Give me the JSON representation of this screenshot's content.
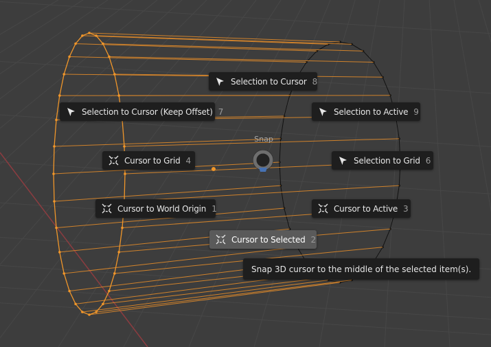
{
  "pie_menu": {
    "title": "Snap",
    "items": [
      {
        "label": "Selection to Cursor",
        "number": "8",
        "icon": "cursor-arrow-icon",
        "active": false
      },
      {
        "label": "Selection to Cursor (Keep Offset)",
        "number": "7",
        "icon": "cursor-arrow-icon",
        "active": false
      },
      {
        "label": "Selection to Active",
        "number": "9",
        "icon": "cursor-arrow-icon",
        "active": false
      },
      {
        "label": "Cursor to Grid",
        "number": "4",
        "icon": "3d-cursor-icon",
        "active": false
      },
      {
        "label": "Selection to Grid",
        "number": "6",
        "icon": "cursor-arrow-icon",
        "active": false
      },
      {
        "label": "Cursor to World Origin",
        "number": "1",
        "icon": "3d-cursor-icon",
        "active": false
      },
      {
        "label": "Cursor to Active",
        "number": "3",
        "icon": "3d-cursor-icon",
        "active": false
      },
      {
        "label": "Cursor to Selected",
        "number": "2",
        "icon": "3d-cursor-icon",
        "active": true
      }
    ]
  },
  "tooltip": "Snap 3D cursor to the middle of the selected item(s).",
  "colors": {
    "background": "#3d3d3d",
    "grid_line": "#474747",
    "x_axis": "#8c3c40",
    "selected_wire": "#f0962a",
    "unselected_wire": "#000000",
    "menu_bg": "#1e1e1e",
    "menu_active": "#5a5a5a",
    "pie_accent": "#4772b3"
  }
}
